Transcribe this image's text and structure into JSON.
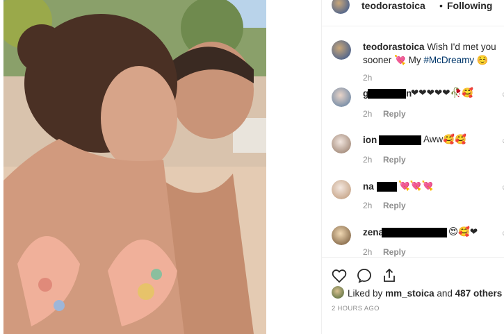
{
  "post": {
    "author": "teodorastoica",
    "separator": "•",
    "follow_status": "Following"
  },
  "caption": {
    "username": "teodorastoica",
    "text_before": "Wish I'd met you sooner",
    "emoji1": "💘",
    "text_mid": "My",
    "hashtag": "#McDreamy",
    "emoji2": "☺️",
    "time": "2h"
  },
  "comments": [
    {
      "name_visible": "g",
      "name_tail": "n",
      "text": "❤❤❤❤❤🥀🥰",
      "time": "2h",
      "reply": "Reply"
    },
    {
      "name_visible": "ion",
      "name_tail": "",
      "text": "Aww🥰🥰",
      "time": "2h",
      "reply": "Reply"
    },
    {
      "name_visible": "na",
      "name_tail": "",
      "text": "💘💘💘",
      "time": "2h",
      "reply": "Reply"
    },
    {
      "name_visible": "zena",
      "name_tail": "",
      "text": "😍🥰❤",
      "time": "2h",
      "reply": "Reply"
    }
  ],
  "likes": {
    "prefix": "Liked by",
    "user": "mm_stoica",
    "joiner": "and",
    "count": "487 others"
  },
  "posted_ago": "2 HOURS AGO",
  "icons": [
    "heart-icon",
    "comment-icon",
    "share-icon",
    "more-options-icon"
  ],
  "colors": {
    "hashtag": "#00376b",
    "muted": "#8e8e8e",
    "text": "#262626",
    "heart": "#e0245e"
  }
}
